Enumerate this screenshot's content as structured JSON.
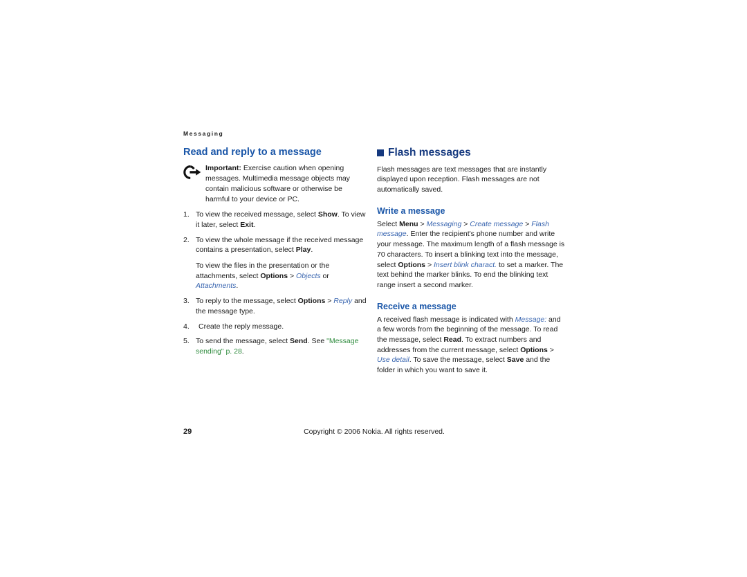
{
  "running_header": "Messaging",
  "left_column": {
    "section_title": "Read and reply to a message",
    "note": {
      "icon": "important-note-icon",
      "label": "Important:",
      "text": " Exercise caution when opening messages. Multimedia message objects may contain malicious software or otherwise be harmful to your device or PC."
    },
    "steps": [
      {
        "num": "1.",
        "parts": [
          {
            "t": "plain",
            "v": "To view the received message, select "
          },
          {
            "t": "bold",
            "v": "Show"
          },
          {
            "t": "plain",
            "v": ". To view it later, select "
          },
          {
            "t": "bold",
            "v": "Exit"
          },
          {
            "t": "plain",
            "v": "."
          }
        ]
      },
      {
        "num": "2.",
        "parts": [
          {
            "t": "plain",
            "v": "To view the whole message if the received message contains a presentation, select "
          },
          {
            "t": "bold",
            "v": "Play"
          },
          {
            "t": "plain",
            "v": "."
          }
        ],
        "extra": [
          {
            "t": "plain",
            "v": "To view the files in the presentation or the attachments, select "
          },
          {
            "t": "bold",
            "v": "Options"
          },
          {
            "t": "plain",
            "v": " > "
          },
          {
            "t": "link",
            "v": "Objects"
          },
          {
            "t": "plain",
            "v": " or "
          },
          {
            "t": "link",
            "v": "Attachments"
          },
          {
            "t": "plain",
            "v": "."
          }
        ]
      },
      {
        "num": "3.",
        "parts": [
          {
            "t": "plain",
            "v": "To reply to the message, select "
          },
          {
            "t": "bold",
            "v": "Options"
          },
          {
            "t": "plain",
            "v": " > "
          },
          {
            "t": "link",
            "v": "Reply"
          },
          {
            "t": "plain",
            "v": " and the message type."
          }
        ]
      },
      {
        "num": "4.",
        "wide_gap": true,
        "parts": [
          {
            "t": "plain",
            "v": "Create the reply message."
          }
        ]
      },
      {
        "num": "5.",
        "parts": [
          {
            "t": "plain",
            "v": "To send the message, select "
          },
          {
            "t": "bold",
            "v": "Send"
          },
          {
            "t": "plain",
            "v": ". See "
          },
          {
            "t": "xref",
            "v": "\"Message sending\""
          },
          {
            "t": "plain",
            "v": " "
          },
          {
            "t": "xref",
            "v": "p. 28"
          },
          {
            "t": "plain",
            "v": "."
          }
        ]
      }
    ]
  },
  "right_column": {
    "chapter_title": "Flash messages",
    "chapter_bullet_color": "#15397f",
    "intro": [
      {
        "t": "plain",
        "v": "Flash messages are text messages that are instantly displayed upon reception. Flash messages are not automatically saved."
      }
    ],
    "sections": [
      {
        "title": "Write a message",
        "parts": [
          {
            "t": "plain",
            "v": "Select "
          },
          {
            "t": "bold",
            "v": "Menu"
          },
          {
            "t": "plain",
            "v": " > "
          },
          {
            "t": "link",
            "v": "Messaging"
          },
          {
            "t": "plain",
            "v": " > "
          },
          {
            "t": "link",
            "v": "Create message"
          },
          {
            "t": "plain",
            "v": " > "
          },
          {
            "t": "link",
            "v": "Flash message"
          },
          {
            "t": "plain",
            "v": ". Enter the recipient's phone number and write your message. The maximum length of a flash message is 70 characters. To insert a blinking text into the message, select "
          },
          {
            "t": "bold",
            "v": "Options"
          },
          {
            "t": "plain",
            "v": " > "
          },
          {
            "t": "link",
            "v": "Insert blink charact."
          },
          {
            "t": "plain",
            "v": " to set a marker. The text behind the marker blinks. To end the blinking text range insert a second marker."
          }
        ]
      },
      {
        "title": "Receive a message",
        "parts": [
          {
            "t": "plain",
            "v": "A received flash message is indicated with "
          },
          {
            "t": "link",
            "v": "Message:"
          },
          {
            "t": "plain",
            "v": " and a few words from the beginning of the message. To read the message, select "
          },
          {
            "t": "bold",
            "v": "Read"
          },
          {
            "t": "plain",
            "v": ". To extract numbers and addresses from the current message, select "
          },
          {
            "t": "bold",
            "v": "Options"
          },
          {
            "t": "plain",
            "v": " > "
          },
          {
            "t": "link",
            "v": "Use detail"
          },
          {
            "t": "plain",
            "v": ". To save the message, select "
          },
          {
            "t": "bold",
            "v": "Save"
          },
          {
            "t": "plain",
            "v": " and the folder in which you want to save it."
          }
        ]
      }
    ]
  },
  "footer": {
    "page_number": "29",
    "copyright": "Copyright © 2006 Nokia. All rights reserved."
  }
}
